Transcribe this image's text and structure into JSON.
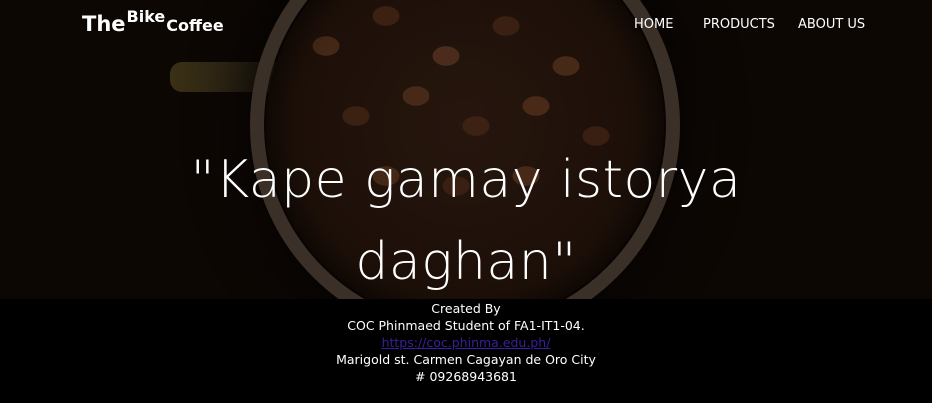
{
  "brand": {
    "the": "The",
    "bike": "Bike",
    "coffee": "Coffee"
  },
  "nav": {
    "home": "HOME",
    "products": "PRODUCTS",
    "about": "ABOUT US"
  },
  "hero": {
    "line1": "\"Kape gamay istorya",
    "line2": "daghan\""
  },
  "footer": {
    "created_by": "Created By",
    "student": "COC Phinmaed Student of FA1-IT1-04.",
    "link": "https://coc.phinma.edu.ph/",
    "address": "Marigold st. Carmen Cagayan de Oro City",
    "phone": "# 09268943681"
  }
}
